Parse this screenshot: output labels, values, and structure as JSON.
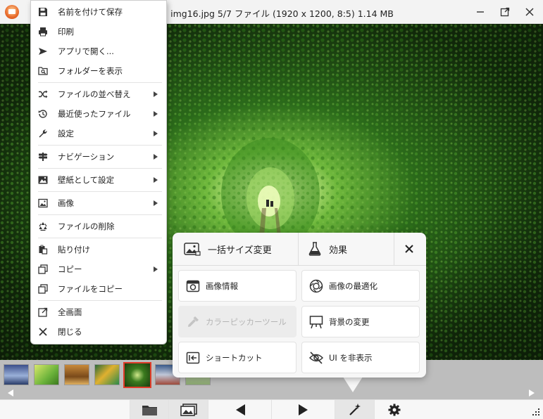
{
  "window": {
    "title": "img16.jpg 5/7 ファイル (1920 x 1200, 8:5) 1.14 MB"
  },
  "context_menu": {
    "items": [
      {
        "label": "名前を付けて保存",
        "icon": "save-icon"
      },
      {
        "label": "印刷",
        "icon": "printer-icon"
      },
      {
        "label": "アプリで開く...",
        "icon": "open-with-icon"
      },
      {
        "label": "フォルダーを表示",
        "icon": "folder-search-icon"
      },
      {
        "label": "ファイルの並べ替え",
        "icon": "shuffle-icon",
        "submenu": true
      },
      {
        "label": "最近使ったファイル",
        "icon": "history-icon",
        "submenu": true
      },
      {
        "label": "設定",
        "icon": "wrench-icon",
        "submenu": true
      },
      {
        "label": "ナビゲーション",
        "icon": "signpost-icon",
        "submenu": true
      },
      {
        "label": "壁紙として設定",
        "icon": "wallpaper-icon",
        "submenu": true
      },
      {
        "label": "画像",
        "icon": "image-icon",
        "submenu": true
      },
      {
        "label": "ファイルの削除",
        "icon": "recycle-icon"
      },
      {
        "label": "貼り付け",
        "icon": "paste-icon"
      },
      {
        "label": "コピー",
        "icon": "copy-icon",
        "submenu": true
      },
      {
        "label": "ファイルをコピー",
        "icon": "copy-file-icon"
      },
      {
        "label": "全画面",
        "icon": "fullscreen-icon"
      },
      {
        "label": "閉じる",
        "icon": "close-icon"
      }
    ]
  },
  "tools_panel": {
    "header": {
      "batch_resize": "一括サイズ変更",
      "effects": "効果"
    },
    "tools": [
      {
        "label": "画像情報",
        "icon": "camera-info-icon",
        "enabled": true
      },
      {
        "label": "画像の最適化",
        "icon": "lens-icon",
        "enabled": true
      },
      {
        "label": "カラーピッカーツール",
        "icon": "eyedropper-icon",
        "enabled": false
      },
      {
        "label": "背景の変更",
        "icon": "easel-icon",
        "enabled": true
      },
      {
        "label": "ショートカット",
        "icon": "shortcut-icon",
        "enabled": true
      },
      {
        "label": "UI を非表示",
        "icon": "eye-off-icon",
        "enabled": true
      }
    ]
  },
  "thumbnails": {
    "count": 7,
    "active_index": 4
  },
  "colors": {
    "accent_active_thumb": "#e03c2a",
    "foliage": "#2f6a1d"
  }
}
